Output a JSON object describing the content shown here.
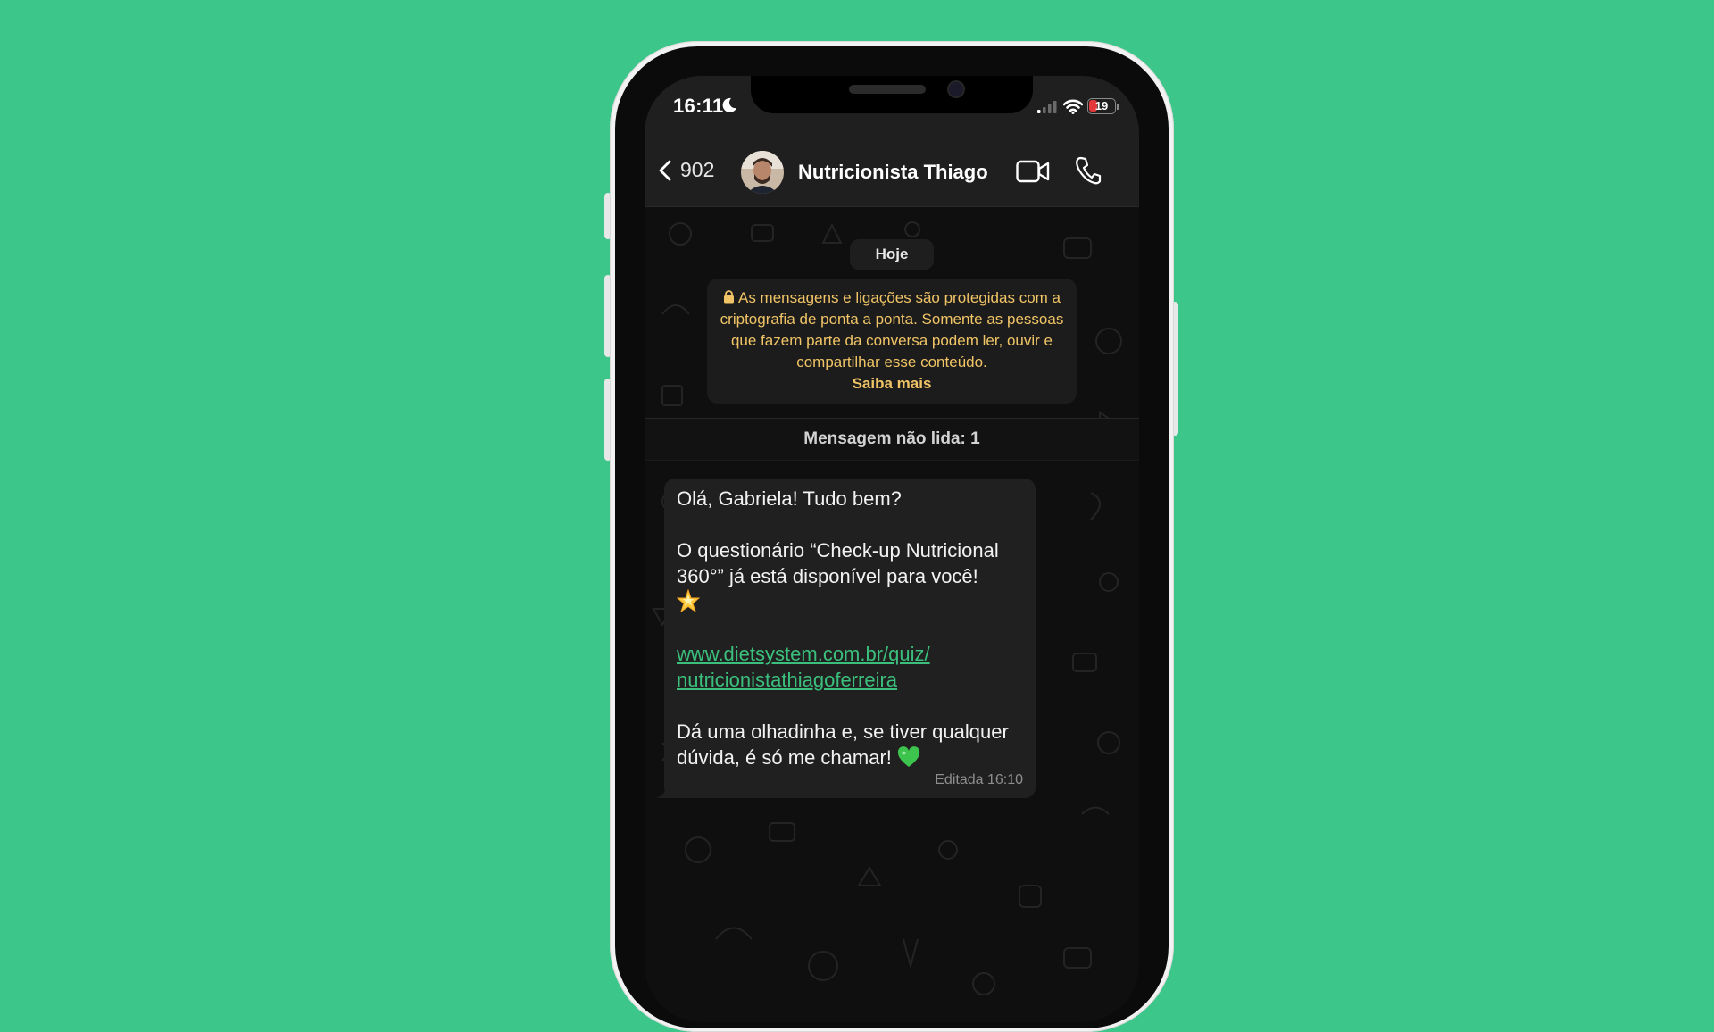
{
  "status_bar": {
    "time": "16:11",
    "battery_level": "19"
  },
  "header": {
    "back_count": "902",
    "contact_name": "Nutricionista Thiago"
  },
  "chat": {
    "date_label": "Hoje",
    "encryption_notice": "As mensagens e ligações são protegidas com a criptografia de ponta a ponta. Somente as pessoas que fazem parte da conversa podem ler, ouvir e compartilhar esse conteúdo.",
    "encryption_link": "Saiba mais",
    "unread_label": "Mensagem não lida: 1",
    "message": {
      "greeting": "Olá, Gabriela! Tudo bem?",
      "body": "O questionário “Check-up Nutricional 360°”  já está disponível para você!",
      "link_line1": "www.dietsystem.com.br/quiz/",
      "link_line2": "nutricionistathiagoferreira",
      "closing": "Dá uma olhadinha e, se tiver qualquer dúvida, é só me chamar!",
      "meta": "Editada 16:10"
    }
  },
  "colors": {
    "background": "#3cc68a",
    "link": "#3bbf7c",
    "notice_text": "#f0c466",
    "battery_low": "#e5383b"
  },
  "icons": {
    "back": "chevron-left-icon",
    "video": "video-camera-icon",
    "call": "phone-icon",
    "lock": "lock-icon",
    "moon": "moon-icon",
    "signal": "cellular-signal-icon",
    "wifi": "wifi-icon",
    "battery": "battery-icon",
    "star": "star-emoji-icon",
    "heart": "green-heart-emoji-icon"
  }
}
